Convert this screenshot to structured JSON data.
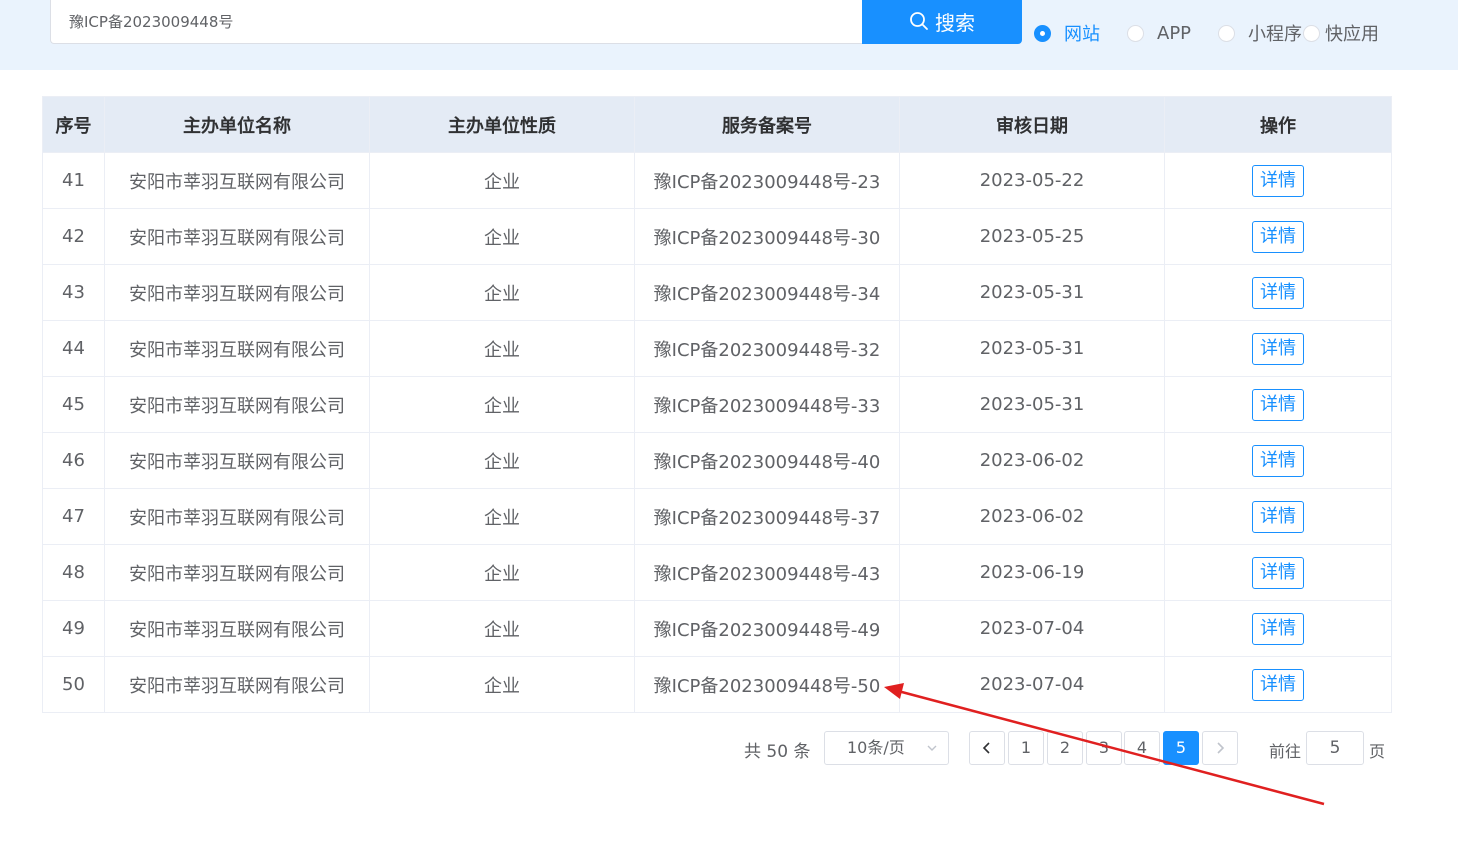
{
  "search": {
    "value": "豫ICP备2023009448号",
    "button_label": "搜索"
  },
  "type_options": [
    {
      "label": "网站",
      "checked": true
    },
    {
      "label": "APP",
      "checked": false
    },
    {
      "label": "小程序",
      "checked": false
    },
    {
      "label": "快应用",
      "checked": false
    }
  ],
  "table": {
    "headers": [
      "序号",
      "主办单位名称",
      "主办单位性质",
      "服务备案号",
      "审核日期",
      "操作"
    ],
    "rows": [
      {
        "no": "41",
        "name": "安阳市莘羽互联网有限公司",
        "type": "企业",
        "record": "豫ICP备2023009448号-23",
        "date": "2023-05-22",
        "action": "详情"
      },
      {
        "no": "42",
        "name": "安阳市莘羽互联网有限公司",
        "type": "企业",
        "record": "豫ICP备2023009448号-30",
        "date": "2023-05-25",
        "action": "详情"
      },
      {
        "no": "43",
        "name": "安阳市莘羽互联网有限公司",
        "type": "企业",
        "record": "豫ICP备2023009448号-34",
        "date": "2023-05-31",
        "action": "详情"
      },
      {
        "no": "44",
        "name": "安阳市莘羽互联网有限公司",
        "type": "企业",
        "record": "豫ICP备2023009448号-32",
        "date": "2023-05-31",
        "action": "详情"
      },
      {
        "no": "45",
        "name": "安阳市莘羽互联网有限公司",
        "type": "企业",
        "record": "豫ICP备2023009448号-33",
        "date": "2023-05-31",
        "action": "详情"
      },
      {
        "no": "46",
        "name": "安阳市莘羽互联网有限公司",
        "type": "企业",
        "record": "豫ICP备2023009448号-40",
        "date": "2023-06-02",
        "action": "详情"
      },
      {
        "no": "47",
        "name": "安阳市莘羽互联网有限公司",
        "type": "企业",
        "record": "豫ICP备2023009448号-37",
        "date": "2023-06-02",
        "action": "详情"
      },
      {
        "no": "48",
        "name": "安阳市莘羽互联网有限公司",
        "type": "企业",
        "record": "豫ICP备2023009448号-43",
        "date": "2023-06-19",
        "action": "详情"
      },
      {
        "no": "49",
        "name": "安阳市莘羽互联网有限公司",
        "type": "企业",
        "record": "豫ICP备2023009448号-49",
        "date": "2023-07-04",
        "action": "详情"
      },
      {
        "no": "50",
        "name": "安阳市莘羽互联网有限公司",
        "type": "企业",
        "record": "豫ICP备2023009448号-50",
        "date": "2023-07-04",
        "action": "详情"
      }
    ]
  },
  "pagination": {
    "total_text": "共 50 条",
    "page_size": "10条/页",
    "pages": [
      "1",
      "2",
      "3",
      "4",
      "5"
    ],
    "current_page": "5",
    "goto_label": "前往",
    "goto_value": "5",
    "page_suffix": "页"
  },
  "colors": {
    "accent": "#1890ff",
    "header_bg": "#e4ebf5",
    "topbar_bg": "#eaf3fd",
    "annotation_arrow": "#e02020"
  },
  "icons": {
    "search_button": "search-icon",
    "prev": "chevron-left-icon",
    "next": "chevron-right-icon",
    "select": "chevron-down-icon"
  }
}
